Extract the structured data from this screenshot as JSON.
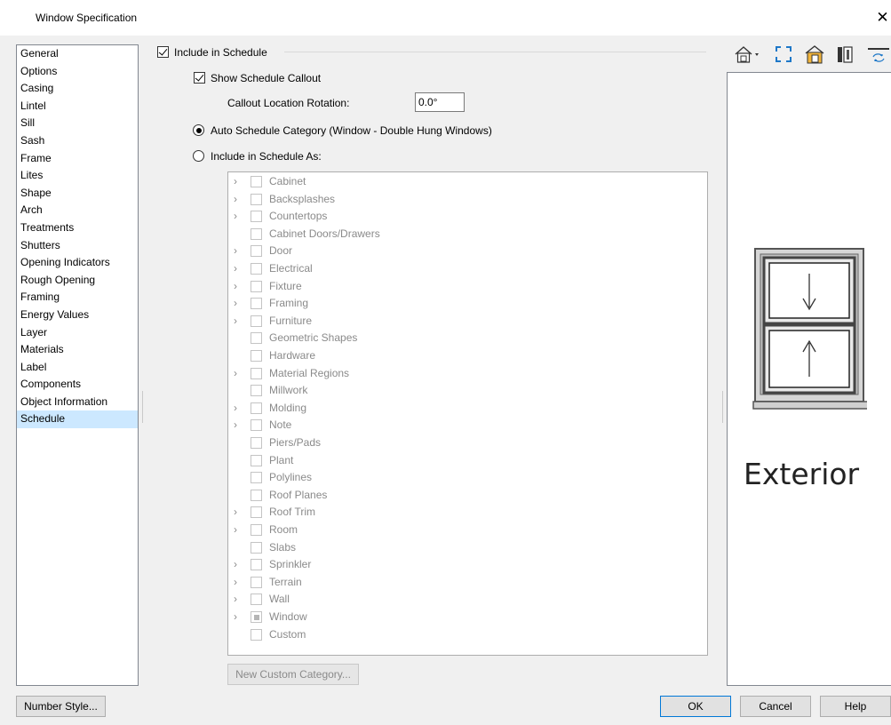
{
  "window": {
    "title": "Window Specification",
    "close_glyph": "✕"
  },
  "nav": {
    "items": [
      "General",
      "Options",
      "Casing",
      "Lintel",
      "Sill",
      "Sash",
      "Frame",
      "Lites",
      "Shape",
      "Arch",
      "Treatments",
      "Shutters",
      "Opening Indicators",
      "Rough Opening",
      "Framing",
      "Energy Values",
      "Layer",
      "Materials",
      "Label",
      "Components",
      "Object Information",
      "Schedule"
    ],
    "selected": "Schedule"
  },
  "schedule": {
    "include_label": "Include in Schedule",
    "include_checked": true,
    "show_callout_label": "Show Schedule Callout",
    "show_callout_checked": true,
    "callout_rotation_label": "Callout Location Rotation:",
    "callout_rotation_value": "0.0°",
    "auto_category_label": "Auto Schedule Category (Window - Double Hung Windows)",
    "auto_category_selected": true,
    "include_as_label": "Include in Schedule As:",
    "include_as_selected": false,
    "categories": [
      {
        "label": "Cabinet",
        "expandable": true,
        "state": "unchecked"
      },
      {
        "label": "Backsplashes",
        "expandable": true,
        "state": "unchecked"
      },
      {
        "label": "Countertops",
        "expandable": true,
        "state": "unchecked"
      },
      {
        "label": "Cabinet Doors/Drawers",
        "expandable": false,
        "state": "unchecked"
      },
      {
        "label": "Door",
        "expandable": true,
        "state": "unchecked"
      },
      {
        "label": "Electrical",
        "expandable": true,
        "state": "unchecked"
      },
      {
        "label": "Fixture",
        "expandable": true,
        "state": "unchecked"
      },
      {
        "label": "Framing",
        "expandable": true,
        "state": "unchecked"
      },
      {
        "label": "Furniture",
        "expandable": true,
        "state": "unchecked"
      },
      {
        "label": "Geometric Shapes",
        "expandable": false,
        "state": "unchecked"
      },
      {
        "label": "Hardware",
        "expandable": false,
        "state": "unchecked"
      },
      {
        "label": "Material Regions",
        "expandable": true,
        "state": "unchecked"
      },
      {
        "label": "Millwork",
        "expandable": false,
        "state": "unchecked"
      },
      {
        "label": "Molding",
        "expandable": true,
        "state": "unchecked"
      },
      {
        "label": "Note",
        "expandable": true,
        "state": "unchecked"
      },
      {
        "label": "Piers/Pads",
        "expandable": false,
        "state": "unchecked"
      },
      {
        "label": "Plant",
        "expandable": false,
        "state": "unchecked"
      },
      {
        "label": "Polylines",
        "expandable": false,
        "state": "unchecked"
      },
      {
        "label": "Roof Planes",
        "expandable": false,
        "state": "unchecked"
      },
      {
        "label": "Roof Trim",
        "expandable": true,
        "state": "unchecked"
      },
      {
        "label": "Room",
        "expandable": true,
        "state": "unchecked"
      },
      {
        "label": "Slabs",
        "expandable": false,
        "state": "unchecked"
      },
      {
        "label": "Sprinkler",
        "expandable": true,
        "state": "unchecked"
      },
      {
        "label": "Terrain",
        "expandable": true,
        "state": "unchecked"
      },
      {
        "label": "Wall",
        "expandable": true,
        "state": "unchecked"
      },
      {
        "label": "Window",
        "expandable": true,
        "state": "partial"
      },
      {
        "label": "Custom",
        "expandable": false,
        "state": "unchecked"
      }
    ],
    "new_custom_category_label": "New Custom Category..."
  },
  "preview": {
    "view_label": "Exterior",
    "toolbar_icons": [
      "view-type-dropdown-icon",
      "fill-window-icon",
      "elevation-view-icon",
      "opening-view-icon",
      "reverse-view-icon"
    ]
  },
  "footer": {
    "number_style_label": "Number Style...",
    "ok_label": "OK",
    "cancel_label": "Cancel",
    "help_label": "Help"
  },
  "colors": {
    "selection": "#cce8ff",
    "disabled_text": "#8a8a8a",
    "default_button_border": "#0078d7"
  }
}
